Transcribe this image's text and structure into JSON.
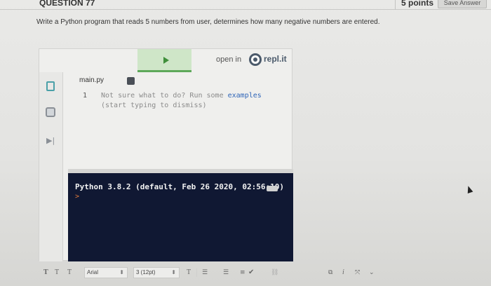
{
  "question": {
    "title": "QUESTION 77",
    "points": "5 points",
    "save_button": "Save Answer",
    "prompt": "Write a Python program that reads 5 numbers from user, determines how many negative numbers are entered."
  },
  "embed": {
    "open_in_label": "open in",
    "replit_brand": "repl.it",
    "file_name": "main.py",
    "editor": {
      "line_number": "1",
      "hint_prefix": "Not sure what to do? Run some ",
      "hint_keyword": "examples",
      "hint_suffix": "(start typing to dismiss)"
    },
    "console": {
      "banner": "Python 3.8.2 (default, Feb 26 2020, 02:56:10)",
      "prompt": ">"
    }
  },
  "toolbar": {
    "text_buttons": [
      "T",
      "T",
      "T"
    ],
    "font_family": "Arial",
    "font_size": "3 (12pt)",
    "format_t": "T"
  },
  "icons": {
    "file": "file-icon",
    "packages": "package-icon",
    "debugger": "debugger-icon",
    "run": "run-icon",
    "brand": "replit-logo-icon"
  },
  "colors": {
    "run_tab_bg": "#cfe6c8",
    "run_accent": "#5ea85a",
    "console_bg": "#101833",
    "keyword": "#2f65b8",
    "prompt_arrow": "#e07a3c"
  }
}
